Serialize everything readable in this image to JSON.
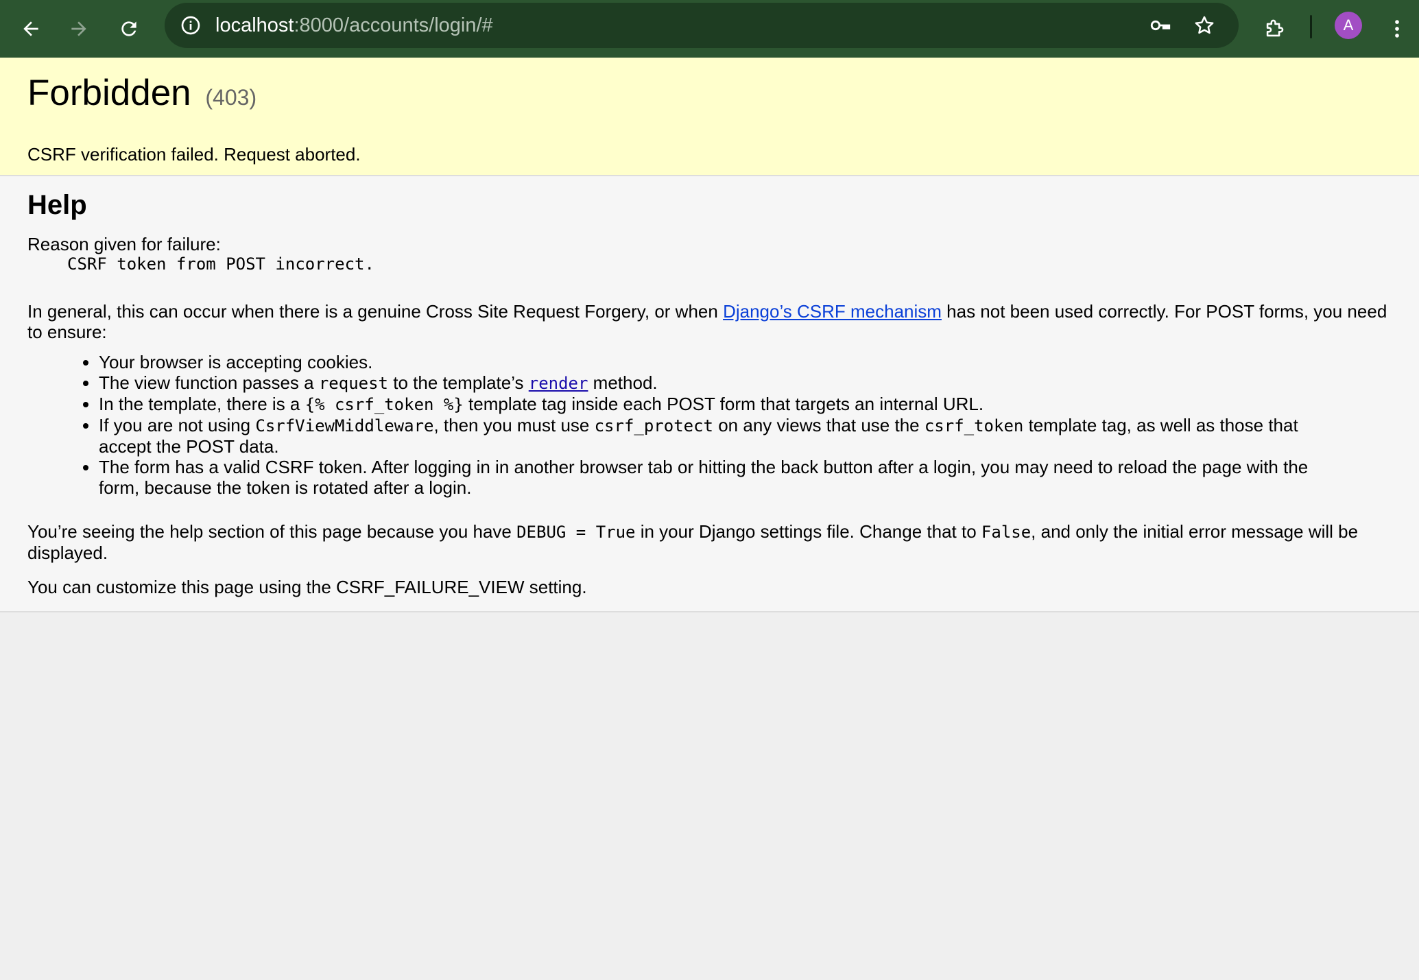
{
  "browser": {
    "url_host": "localhost",
    "url_rest": ":8000/accounts/login/#",
    "profile_initial": "A",
    "icons": {
      "back": "back-arrow-icon",
      "forward": "forward-arrow-icon",
      "reload": "reload-icon",
      "site_info": "site-info-icon",
      "password": "key-icon",
      "bookmark": "star-icon",
      "extensions": "puzzle-icon",
      "menu": "kebab-menu-icon"
    },
    "colors": {
      "toolbar": "#2c5530",
      "omnibox": "#1e3d22",
      "avatar": "#a24ec4"
    }
  },
  "summary": {
    "title": "Forbidden",
    "status_code": "(403)",
    "message": "CSRF verification failed. Request aborted."
  },
  "help": {
    "heading": "Help",
    "reason_label": "Reason given for failure:",
    "reason": "CSRF token from POST incorrect.",
    "general_pre": "In general, this can occur when there is a genuine Cross Site Request Forgery, or when ",
    "general_link": "Django’s CSRF mechanism",
    "general_post": " has not been used correctly. For POST forms, you need to ensure:",
    "bullet1": "Your browser is accepting cookies.",
    "bullet2_a": "The view function passes a ",
    "bullet2_code": "request",
    "bullet2_b": " to the template’s ",
    "bullet2_link": "render",
    "bullet2_c": " method.",
    "bullet3_a": "In the template, there is a ",
    "bullet3_code": "{% csrf_token %}",
    "bullet3_b": " template tag inside each POST form that targets an internal URL.",
    "bullet4_a": "If you are not using ",
    "bullet4_code1": "CsrfViewMiddleware",
    "bullet4_b": ", then you must use ",
    "bullet4_code2": "csrf_protect",
    "bullet4_c": " on any views that use the ",
    "bullet4_code3": "csrf_token",
    "bullet4_d": " template tag, as well as those that accept the POST data.",
    "bullet5": "The form has a valid CSRF token. After logging in in another browser tab or hitting the back button after a login, you may need to reload the page with the form, because the token is rotated after a login.",
    "debug_a": "You’re seeing the help section of this page because you have ",
    "debug_code1": "DEBUG = True",
    "debug_b": " in your Django settings file. Change that to ",
    "debug_code2": "False",
    "debug_c": ", and only the initial error message will be displayed.",
    "customize": "You can customize this page using the CSRF_FAILURE_VIEW setting."
  }
}
